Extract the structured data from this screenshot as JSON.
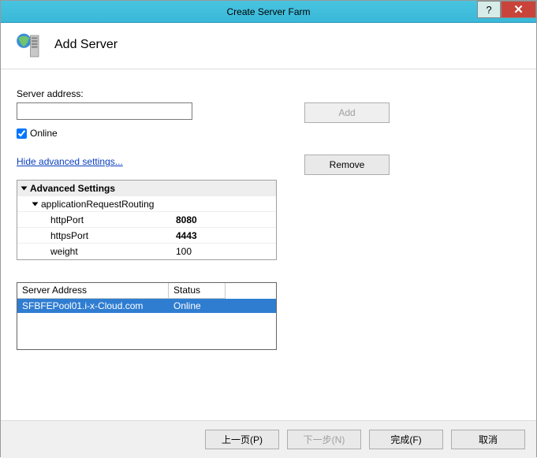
{
  "window": {
    "title": "Create Server Farm",
    "help": "?",
    "close": "✕"
  },
  "header": {
    "title": "Add Server"
  },
  "form": {
    "server_address_label": "Server address:",
    "server_address_value": "",
    "online_label": "Online",
    "advanced_link": "Hide advanced settings..."
  },
  "buttons": {
    "add": "Add",
    "remove": "Remove"
  },
  "advanced": {
    "title": "Advanced Settings",
    "group": "applicationRequestRouting",
    "rows": [
      {
        "name": "httpPort",
        "value": "8080",
        "bold": true
      },
      {
        "name": "httpsPort",
        "value": "4443",
        "bold": true
      },
      {
        "name": "weight",
        "value": "100",
        "bold": false
      }
    ]
  },
  "table": {
    "col_server": "Server Address",
    "col_status": "Status",
    "rows": [
      {
        "server": "SFBFEPool01.i-x-Cloud.com",
        "status": "Online",
        "selected": true
      }
    ]
  },
  "footer": {
    "prev": "上一页(P)",
    "next": "下一步(N)",
    "finish": "完成(F)",
    "cancel": "取消"
  }
}
